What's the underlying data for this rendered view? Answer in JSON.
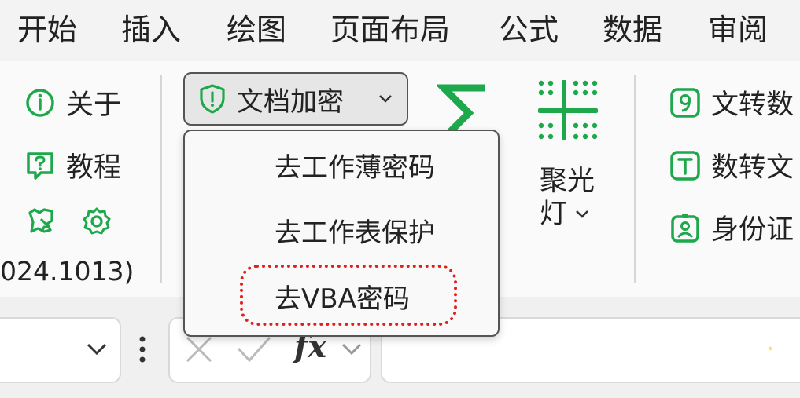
{
  "tabs": [
    "开始",
    "插入",
    "绘图",
    "页面布局",
    "公式",
    "数据",
    "审阅"
  ],
  "left_group": {
    "about": "关于",
    "tutorial": "教程",
    "version": "024.1013)"
  },
  "encrypt": {
    "label": "文档加密",
    "menu": [
      "去工作薄密码",
      "去工作表保护",
      "去VBA密码"
    ]
  },
  "spotlight": {
    "line1": "聚光",
    "line2": "灯"
  },
  "right_group": {
    "text_to_num": "文转数",
    "num_to_text": "数转文",
    "id_card": "身份证"
  },
  "formula_bar": {
    "fx": "fx"
  },
  "colors": {
    "accent_green": "#1ea84c",
    "highlight_red": "#e0201c"
  }
}
